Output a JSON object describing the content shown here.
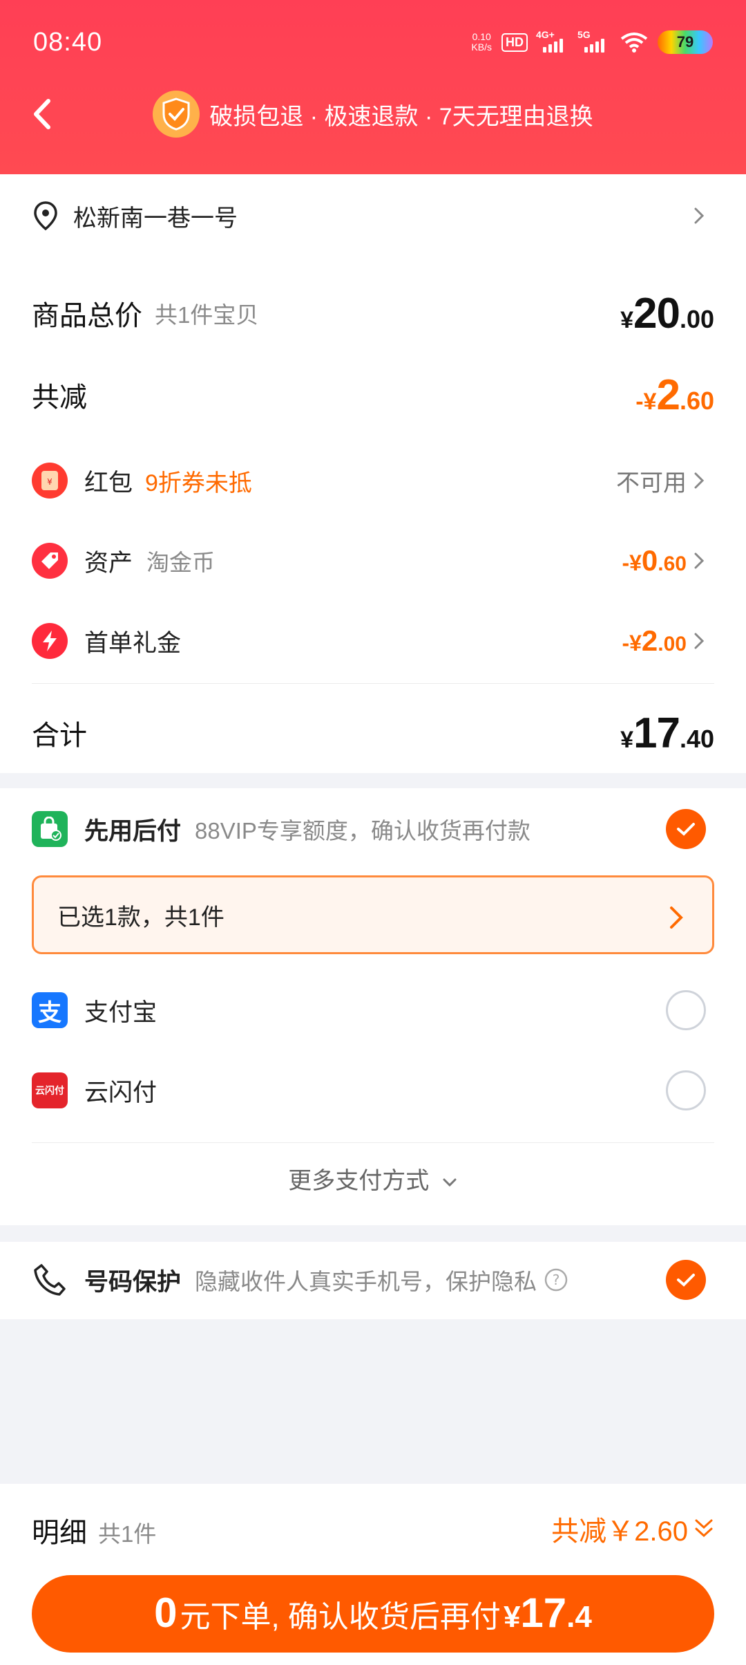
{
  "status_bar": {
    "time": "08:40",
    "net_speed": "0.10",
    "net_unit": "KB/s",
    "hd": "HD",
    "sig1": "4G+",
    "sig2": "5G",
    "battery": "79"
  },
  "nav": {
    "title": "破损包退 · 极速退款 · 7天无理由退换"
  },
  "address": {
    "text": "松新南一巷一号"
  },
  "summary": {
    "total_label": "商品总价",
    "total_sub": "共1件宝贝",
    "total_cur": "¥",
    "total_int": "20",
    "total_dec": ".00",
    "discount_label": "共减",
    "discount_cur": "-¥",
    "discount_int": "2",
    "discount_dec": ".60"
  },
  "items": [
    {
      "label": "红包",
      "note": "9折券未抵",
      "right": "不可用"
    },
    {
      "label": "资产",
      "note": "淘金币",
      "cur": "-¥",
      "int": "0",
      "dec": ".60"
    },
    {
      "label": "首单礼金",
      "cur": "-¥",
      "int": "2",
      "dec": ".00"
    }
  ],
  "sum": {
    "label": "合计",
    "cur": "¥",
    "int": "17",
    "dec": ".40"
  },
  "payment": {
    "bnpl_label": "先用后付",
    "bnpl_note": "88VIP专享额度，确认收货再付款",
    "selected_text": "已选1款，共1件",
    "alipay": "支付宝",
    "unionpay": "云闪付",
    "unionpay_icon": "云闪付",
    "more": "更多支付方式"
  },
  "privacy": {
    "label": "号码保护",
    "note": "隐藏收件人真实手机号，保护隐私"
  },
  "bottom": {
    "detail": "明细",
    "detail_sub": "共1件",
    "saving": "共减￥2.60",
    "cta_num": "0",
    "cta_text": "元下单, 确认收货后再付",
    "cta_cur": "¥",
    "cta_int": "17",
    "cta_dec": ".4"
  },
  "colors": {
    "brand_red": "#ff4a52",
    "accent_orange": "#ff5a00"
  }
}
